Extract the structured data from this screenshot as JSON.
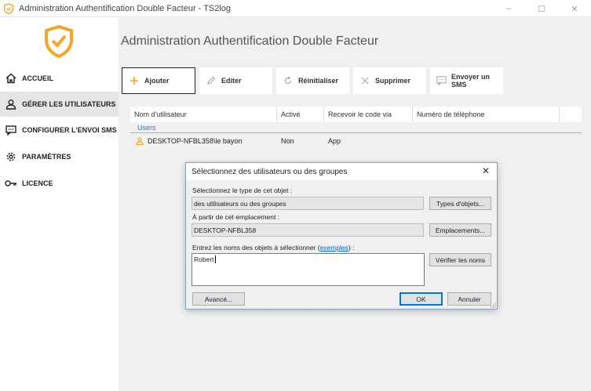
{
  "window": {
    "title": "Administration Authentification Double Facteur - TS2log",
    "controls": [
      "–",
      "☐",
      "✕"
    ]
  },
  "sidebar": {
    "items": [
      {
        "label": "ACCUEIL",
        "icon": "home-icon",
        "active": false
      },
      {
        "label": "GÉRER LES UTILISATEURS",
        "icon": "user-icon",
        "active": true
      },
      {
        "label": "CONFIGURER L'ENVOI SMS",
        "icon": "sms-icon",
        "active": false
      },
      {
        "label": "PARAMÈTRES",
        "icon": "gear-icon",
        "active": false
      },
      {
        "label": "LICENCE",
        "icon": "key-icon",
        "active": false
      }
    ]
  },
  "main": {
    "title": "Administration Authentification Double Facteur",
    "toolbar": {
      "add": "Ajouter",
      "edit": "Editer",
      "reset": "Réinitialiser",
      "delete": "Supprimer",
      "sms": "Envoyer un SMS"
    },
    "grid": {
      "columns": [
        "Nom d'utilisateur",
        "Activé",
        "Recevoir le code via",
        "Numéro de téléphone"
      ],
      "group": "Users",
      "rows": [
        {
          "user": "DESKTOP-NFBL358\\le bayon",
          "active": "Non",
          "via": "App",
          "phone": ""
        }
      ]
    }
  },
  "dialog": {
    "title": "Sélectionnez des utilisateurs ou des groupes",
    "type_label": "Sélectionnez le type de cet objet :",
    "type_value": "des utilisateurs ou des groupes",
    "type_button": "Types d'objets...",
    "location_label": "À partir de cet emplacement :",
    "location_value": "DESKTOP-NFBL358",
    "location_button": "Emplacements...",
    "names_label_prefix": "Entrez les noms des objets à sélectionner (",
    "names_label_link": "exemples",
    "names_label_suffix": ") :",
    "names_value": "Robert",
    "check_button": "Vérifier les noms",
    "advanced_button": "Avancé...",
    "ok_button": "OK",
    "cancel_button": "Annuler"
  },
  "colors": {
    "accent": "#f5a623",
    "sidebar_active": "#e5e5e5",
    "main_bg": "#f0f0f0",
    "group_text": "#3a6fb5",
    "dialog_default_border": "#0078d7"
  }
}
